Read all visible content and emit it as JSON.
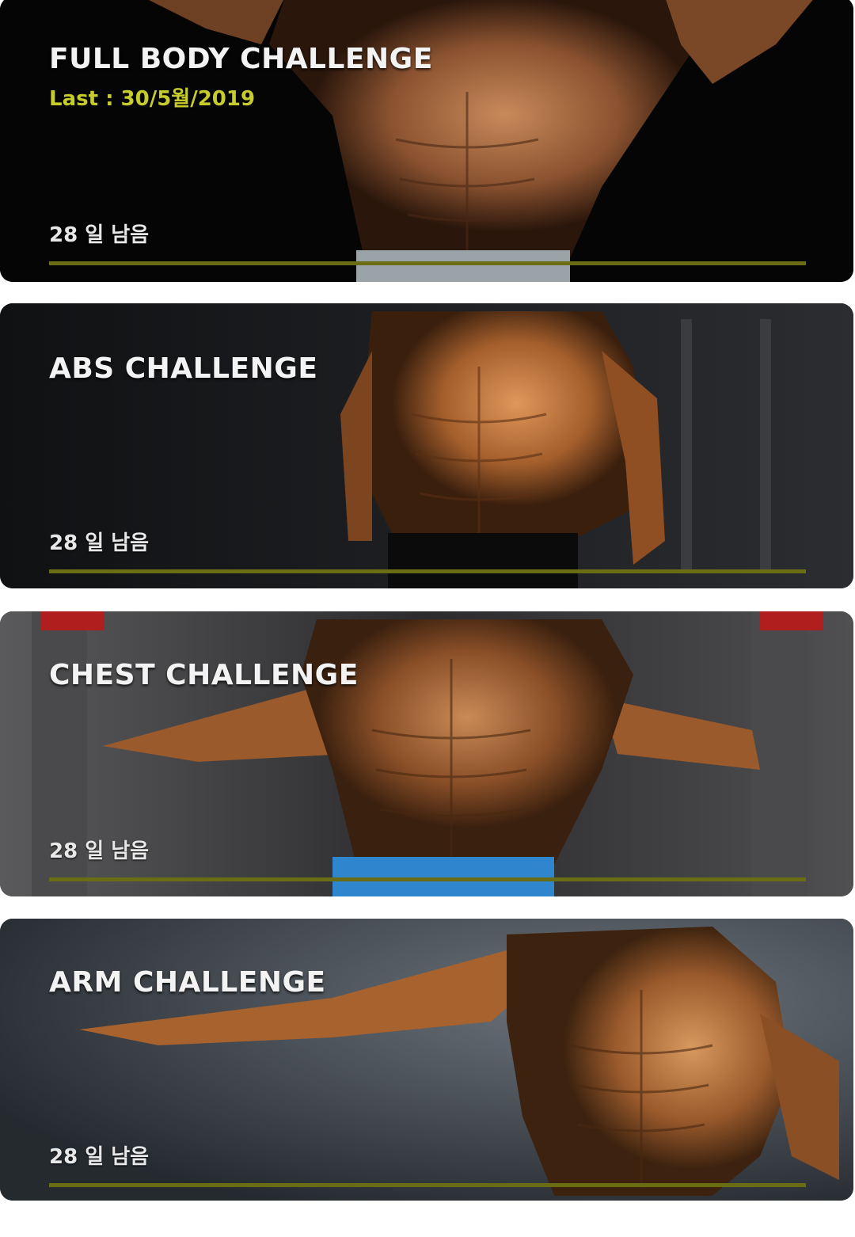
{
  "accent_color": "#d7de2c",
  "challenges": [
    {
      "title": "FULL BODY CHALLENGE",
      "last": "Last : 30/5월/2019",
      "remaining": "28 일 남음",
      "progress": 0
    },
    {
      "title": "ABS CHALLENGE",
      "remaining": "28 일 남음",
      "progress": 0
    },
    {
      "title": "CHEST CHALLENGE",
      "remaining": "28 일 남음",
      "progress": 0
    },
    {
      "title": "ARM CHALLENGE",
      "remaining": "28 일 남음",
      "progress": 0
    }
  ]
}
